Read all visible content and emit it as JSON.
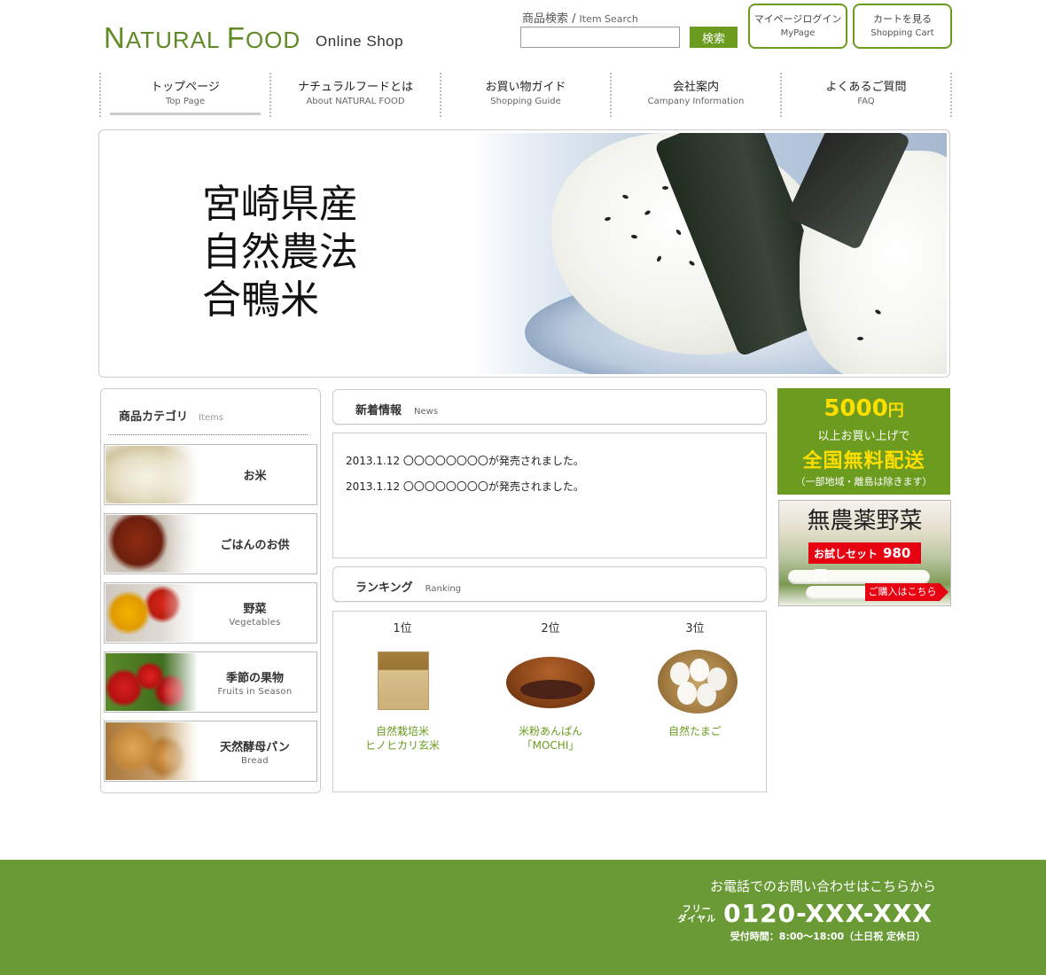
{
  "header": {
    "logo_n": "N",
    "logo_atural": "ATURAL",
    "logo_f": "F",
    "logo_ood": "OOD",
    "logo_sub": "Online Shop",
    "search_label_jp": "商品検索 /",
    "search_label_en": "Item Search",
    "search_value": "",
    "search_button": "検索",
    "mypage_jp": "マイページログイン",
    "mypage_en": "MyPage",
    "cart_jp": "カートを見る",
    "cart_en": "Shopping Cart"
  },
  "nav": [
    {
      "jp": "トップページ",
      "en": "Top Page"
    },
    {
      "jp": "ナチュラルフードとは",
      "en": "About NATURAL FOOD"
    },
    {
      "jp": "お買い物ガイド",
      "en": "Shopping Guide"
    },
    {
      "jp": "会社案内",
      "en": "Campany Information"
    },
    {
      "jp": "よくあるご質問",
      "en": "FAQ"
    }
  ],
  "hero": {
    "line1": "宮崎県産",
    "line2": "自然農法",
    "line3": "合鴨米"
  },
  "sidebar": {
    "title_jp": "商品カテゴリ",
    "title_en": "Items",
    "categories": [
      {
        "jp": "お米",
        "en": ""
      },
      {
        "jp": "ごはんのお供",
        "en": ""
      },
      {
        "jp": "野菜",
        "en": "Vegetables"
      },
      {
        "jp": "季節の果物",
        "en": "Fruits in Season"
      },
      {
        "jp": "天然酵母パン",
        "en": "Bread"
      }
    ]
  },
  "news": {
    "title_jp": "新着情報",
    "title_en": "News",
    "items": [
      "2013.1.12 〇〇〇〇〇〇〇〇が発売されました。",
      "2013.1.12 〇〇〇〇〇〇〇〇が発売されました。"
    ]
  },
  "ranking": {
    "title_jp": "ランキング",
    "title_en": "Ranking",
    "items": [
      {
        "pos": "1位",
        "name1": "自然栽培米",
        "name2": "ヒノヒカリ玄米"
      },
      {
        "pos": "2位",
        "name1": "米粉あんぱん",
        "name2": "「MOCHI」"
      },
      {
        "pos": "3位",
        "name1": "自然たまご",
        "name2": ""
      }
    ]
  },
  "promo": {
    "amount": "5000",
    "yen": "円",
    "line2": "以上お買い上げで",
    "line3": "全国無料配送",
    "line4": "（一部地域・離島は除きます）"
  },
  "veg_banner": {
    "title": "無農薬野菜",
    "tag": "お試しセット",
    "price": "980円",
    "buy": "ご購入はこちら"
  },
  "footer": {
    "line1": "お電話でのお問い合わせはこちらから",
    "free_label1": "フリー",
    "free_label2": "ダイヤル",
    "phone": "0120-XXX-XXX",
    "hours": "受付時間：8:00〜18:00（土日祝 定休日）"
  },
  "colors": {
    "brand_green": "#6b9b1f",
    "footer_green": "#6a9a35",
    "promo_yellow": "#ffde00",
    "sale_red": "#e60012"
  }
}
